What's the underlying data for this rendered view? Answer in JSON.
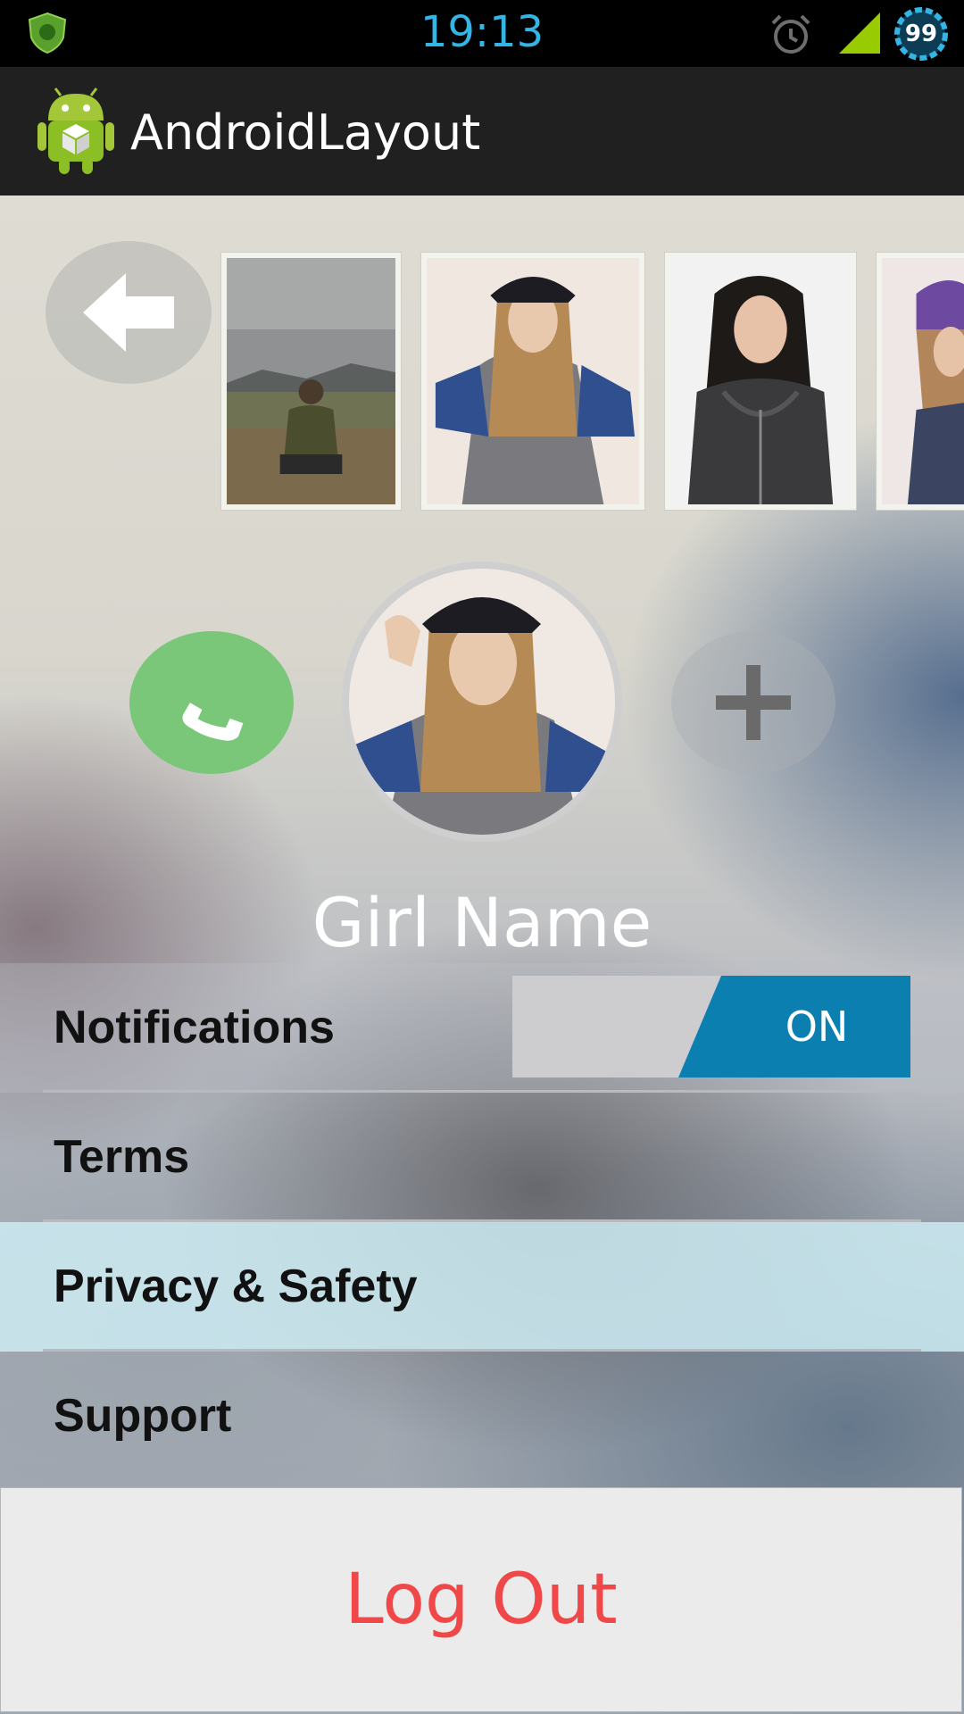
{
  "status_bar": {
    "time": "19:13",
    "battery_level": "99",
    "icons": [
      "shield-icon",
      "alarm-icon",
      "signal-icon",
      "battery-icon"
    ]
  },
  "action_bar": {
    "title": "AndroidLayout",
    "icon": "android-icon"
  },
  "gallery": {
    "back_icon": "arrow-left-icon",
    "thumbnails": [
      "photo-1",
      "photo-2",
      "photo-3",
      "photo-4"
    ]
  },
  "profile": {
    "name": "Girl Name",
    "call_icon": "phone-icon",
    "add_icon": "plus-icon"
  },
  "settings": {
    "notifications": {
      "label": "Notifications",
      "toggle": "ON"
    },
    "terms": "Terms",
    "privacy": "Privacy & Safety",
    "support": "Support"
  },
  "logout_label": "Log Out",
  "colors": {
    "accent_blue": "#0b80b0",
    "status_blue": "#33b5e5",
    "call_green": "#7ac77a",
    "logout_red": "#f04848",
    "highlight": "#cdebf2"
  }
}
